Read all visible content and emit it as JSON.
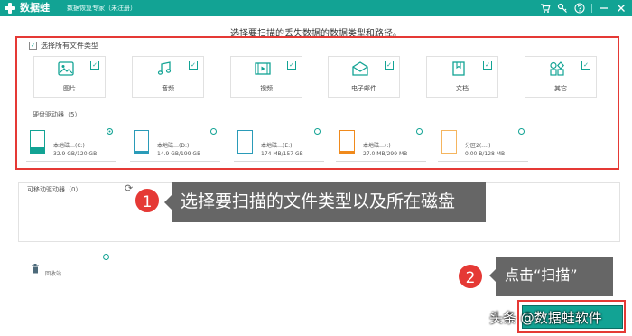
{
  "app": {
    "name": "数据蛙",
    "subtitle": "数据恢复专家（未注册）"
  },
  "titlebar_icons": [
    "cart-icon",
    "key-icon",
    "help-icon",
    "minimize-icon",
    "close-icon"
  ],
  "instruction": "选择要扫描的丢失数据的数据类型和路径。",
  "select_all": {
    "label": "选择所有文件类型",
    "checked": true
  },
  "file_types": [
    {
      "label": "图片",
      "icon": "image-icon",
      "checked": true
    },
    {
      "label": "音频",
      "icon": "audio-icon",
      "checked": true
    },
    {
      "label": "视频",
      "icon": "video-icon",
      "checked": true
    },
    {
      "label": "电子邮件",
      "icon": "email-icon",
      "checked": true
    },
    {
      "label": "文档",
      "icon": "document-icon",
      "checked": true
    },
    {
      "label": "其它",
      "icon": "other-icon",
      "checked": true
    }
  ],
  "disks_title": "硬盘驱动器（5）",
  "disks": [
    {
      "name": "本地磁…(C:)",
      "size": "32.9 GB/120 GB",
      "selected": true,
      "fill": 0.27,
      "color": "#12a394"
    },
    {
      "name": "本地磁…(D:)",
      "size": "14.9 GB/199 GB",
      "selected": false,
      "fill": 0.07,
      "color": "#2a9bb8"
    },
    {
      "name": "本地磁…(E:)",
      "size": "174 MB/157 GB",
      "selected": false,
      "fill": 0.0,
      "color": "#2a9bb8"
    },
    {
      "name": "本地磁…(:)",
      "size": "27.0 MB/299 MB",
      "selected": false,
      "fill": 0.09,
      "color": "#f08a1c"
    },
    {
      "name": "分区2(…:)",
      "size": "0.00  B/128 MB",
      "selected": false,
      "fill": 0.0,
      "color": "#f5b55e"
    }
  ],
  "removable": {
    "title": "可移动驱动器（0）"
  },
  "recycle": {
    "label": "回收站"
  },
  "callouts": {
    "step1_number": "1",
    "step1_text": "选择要扫描的文件类型以及所在磁盘",
    "step2_number": "2",
    "step2_text": "点击“扫描”"
  },
  "watermark": "头条 @数据蛙软件",
  "colors": {
    "brand": "#12a394",
    "highlight": "#e53935",
    "callout": "#666666"
  }
}
